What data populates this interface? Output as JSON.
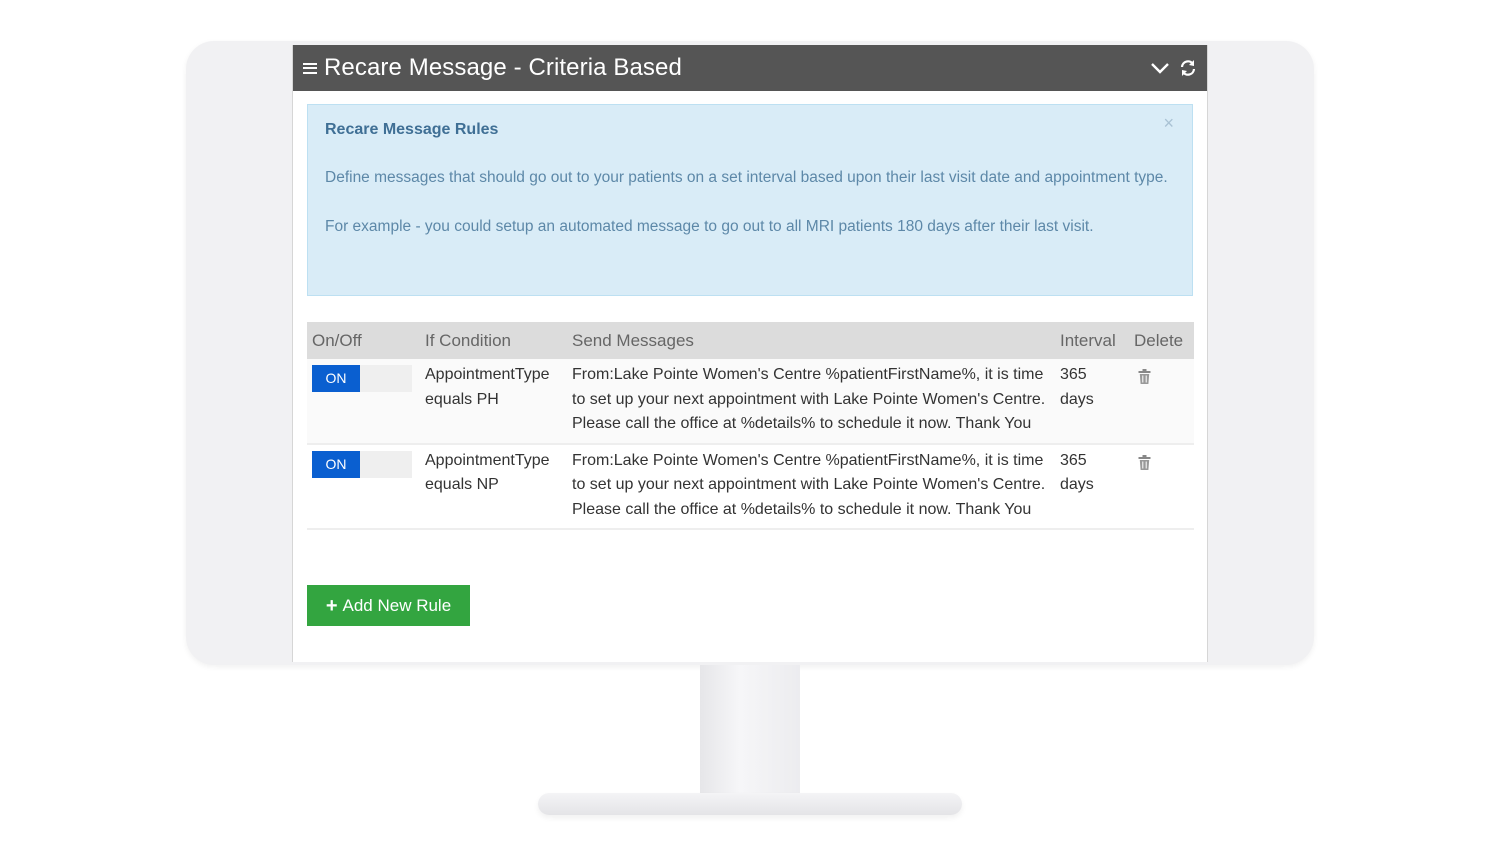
{
  "window": {
    "title": "Recare Message - Criteria Based"
  },
  "alert": {
    "title": "Recare Message Rules",
    "paragraph1": "Define messages that should go out to your patients on a set interval based upon their last visit date and appointment type.",
    "paragraph2": "For example - you could setup an automated message to go out to all MRI patients 180 days after their last visit.",
    "close": "×"
  },
  "table": {
    "headers": {
      "onoff": "On/Off",
      "condition": "If Condition",
      "message": "Send Messages",
      "interval": "Interval",
      "delete": "Delete"
    },
    "rows": [
      {
        "toggle": "ON",
        "condition": "AppointmentType equals PH",
        "message": "From:Lake Pointe Women's Centre %patientFirstName%, it is time to set up your next appointment with Lake Pointe Women's Centre. Please call the office at %details% to schedule it now. Thank You",
        "interval": "365 days"
      },
      {
        "toggle": "ON",
        "condition": "AppointmentType equals NP",
        "message": "From:Lake Pointe Women's Centre %patientFirstName%, it is time to set up your next appointment with Lake Pointe Women's Centre. Please call the office at %details% to schedule it now. Thank You",
        "interval": "365 days"
      }
    ]
  },
  "actions": {
    "add_plus": "+",
    "add_label": "Add New Rule"
  },
  "icons": {
    "menu": "hamburger-icon",
    "collapse": "chevron-down-icon",
    "refresh": "refresh-icon",
    "delete": "trash-icon"
  },
  "colors": {
    "titlebar": "#555555",
    "alert_bg": "#d9ecf7",
    "toggle_on": "#0a5fd0",
    "add_button": "#33a540"
  }
}
